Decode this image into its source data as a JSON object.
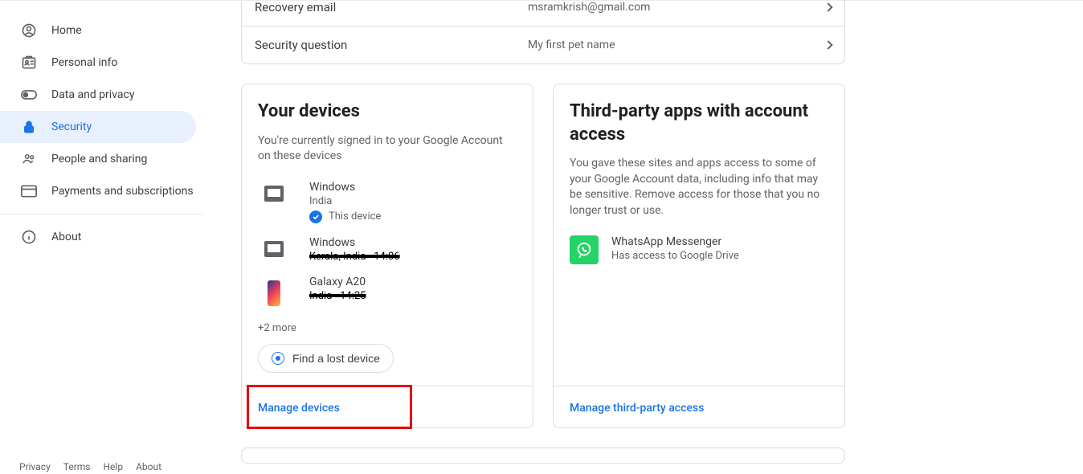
{
  "sidebar": {
    "items": [
      {
        "label": "Home"
      },
      {
        "label": "Personal info"
      },
      {
        "label": "Data and privacy"
      },
      {
        "label": "Security"
      },
      {
        "label": "People and sharing"
      },
      {
        "label": "Payments and subscriptions"
      },
      {
        "label": "About"
      }
    ]
  },
  "footer": {
    "privacy": "Privacy",
    "terms": "Terms",
    "help": "Help",
    "about": "About"
  },
  "recovery": {
    "email_label": "Recovery email",
    "email_value": "msramkrish@gmail.com",
    "question_label": "Security question",
    "question_value": "My first pet name"
  },
  "devices": {
    "title": "Your devices",
    "desc": "You're currently signed in to your Google Account on these devices",
    "items": [
      {
        "name": "Windows",
        "sub": "India",
        "this_device": "This device"
      },
      {
        "name": "Windows",
        "sub": "Kerala, India · 14:06"
      },
      {
        "name": "Galaxy A20",
        "sub": "India · 14:25"
      }
    ],
    "more": "+2 more",
    "find_lost": "Find a lost device",
    "manage": "Manage devices"
  },
  "thirdparty": {
    "title": "Third-party apps with account access",
    "desc": "You gave these sites and apps access to some of your Google Account data, including info that may be sensitive. Remove access for those that you no longer trust or use.",
    "app_name": "WhatsApp Messenger",
    "app_sub": "Has access to Google Drive",
    "manage": "Manage third-party access"
  }
}
